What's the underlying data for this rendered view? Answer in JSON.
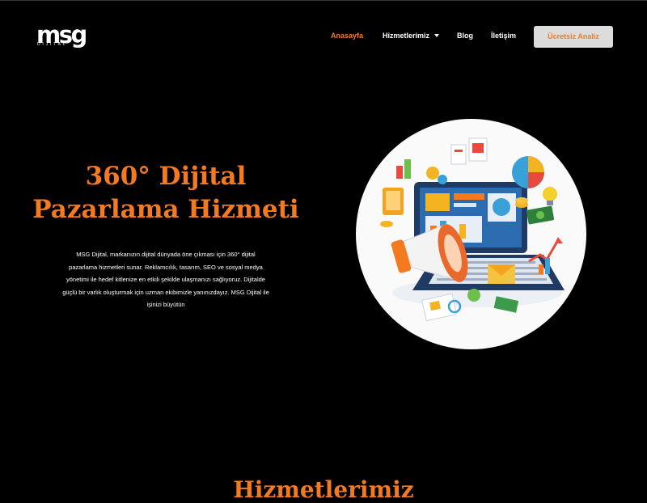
{
  "brand": {
    "logo_text": "msg",
    "logo_tagline": "DIJITAL"
  },
  "nav": {
    "items": [
      {
        "label": "Anasayfa",
        "active": true
      },
      {
        "label": "Hizmetlerimiz",
        "has_dropdown": true
      },
      {
        "label": "Blog"
      },
      {
        "label": "İletişim"
      }
    ],
    "cta_label": "Ücretsiz Analiz"
  },
  "hero": {
    "title_line1": "360° Dijital",
    "title_line2": "Pazarlama Hizmeti",
    "description_lines": [
      "MSG Dijital, markanızın dijital dünyada öne çıkması için 360° dijital",
      "pazarlama hizmetleri sunar. Reklamcılık, tasarım, SEO ve sosyal medya",
      "yönetimi ile hedef kitlenize en etkili şekilde ulaşmanızı sağlıyoruz. Dijitalde",
      "güçlü bir varlık oluşturmak için uzman ekibimizle yanınızdayız. MSG Dijital ile",
      "işinizi büyütün"
    ],
    "illustration": "digital-marketing-laptop-megaphone-illustration"
  },
  "section": {
    "title": "Hizmetlerimiz"
  },
  "colors": {
    "accent": "#f47a20",
    "background": "#000000",
    "cta_bg": "#dcdcdc"
  }
}
